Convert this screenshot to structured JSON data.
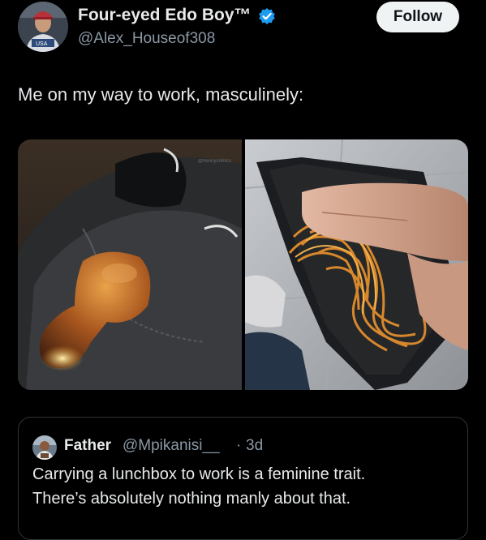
{
  "author": {
    "display_name": "Four-eyed Edo Boy™",
    "handle": "@Alex_Houseof308",
    "verified": true,
    "avatar_icon": "profile-photo"
  },
  "follow_button": {
    "label": "Follow"
  },
  "tweet": {
    "text": "Me on my way to work, masculinely:"
  },
  "media": {
    "images": [
      {
        "icon": "photo-chicken-drumstick-in-pants-pocket"
      },
      {
        "icon": "photo-spaghetti-in-wallet"
      }
    ]
  },
  "quoted_tweet": {
    "display_name": "Father",
    "handle": "@Mpikanisi__",
    "separator": "·",
    "time": "3d",
    "text_line1": "Carrying a lunchbox to work is a feminine trait.",
    "text_line2": "There’s absolutely nothing manly about that.",
    "avatar_icon": "profile-photo"
  },
  "colors": {
    "background": "#000000",
    "text_primary": "#e7e9ea",
    "text_secondary": "#8b98a5",
    "verified_blue": "#1d9bf0",
    "follow_bg": "#eff3f4",
    "border": "#2f3336"
  }
}
